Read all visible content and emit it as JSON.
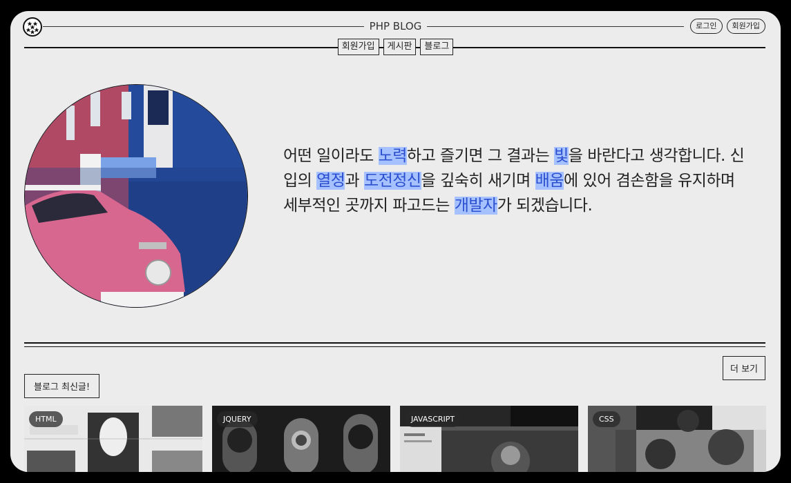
{
  "header": {
    "title": "PHP BLOG",
    "actions": [
      {
        "label": "로그인"
      },
      {
        "label": "회원가입"
      }
    ],
    "nav": [
      {
        "label": "회원가입"
      },
      {
        "label": "게시판"
      },
      {
        "label": "블로그"
      }
    ],
    "logo_icon": "stars-logo-icon"
  },
  "hero": {
    "image_icon": "pink-car-photo",
    "text": [
      {
        "t": "어떤 일이라도 ",
        "h": false
      },
      {
        "t": "노력",
        "h": true
      },
      {
        "t": "하고 즐기면 그 결과는 ",
        "h": false
      },
      {
        "t": "빛",
        "h": true
      },
      {
        "t": "을 바란다고 생각합니다. 신입의 ",
        "h": false
      },
      {
        "t": "열정",
        "h": true
      },
      {
        "t": "과 ",
        "h": false
      },
      {
        "t": "도전정신",
        "h": true
      },
      {
        "t": "을 깊숙히 새기며 ",
        "h": false
      },
      {
        "t": "배움",
        "h": true
      },
      {
        "t": "에 있어 겸손함을 유지하며 세부적인 곳까지 파고드는 ",
        "h": false
      },
      {
        "t": "개발자",
        "h": true
      },
      {
        "t": "가 되겠습니다.",
        "h": false
      }
    ],
    "highlight_bg": "#a6c1ff",
    "highlight_fg": "#2c4fd0"
  },
  "section": {
    "more_label": "더 보기",
    "recent_label": "블로그 최신글!"
  },
  "cards": [
    {
      "tag": "HTML"
    },
    {
      "tag": "JQUERY"
    },
    {
      "tag": "JAVASCRIPT"
    },
    {
      "tag": "CSS"
    }
  ],
  "colors": {
    "background": "#ececec",
    "frame": "#000000"
  }
}
